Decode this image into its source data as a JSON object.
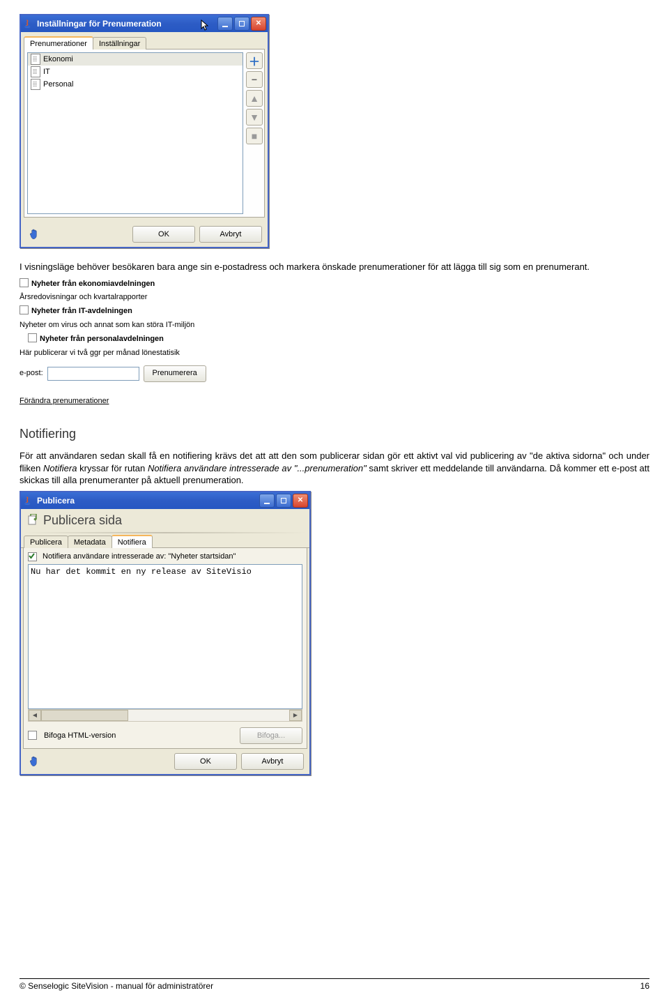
{
  "dialog1": {
    "title": "Inställningar för Prenumeration",
    "tabs": [
      "Prenumerationer",
      "Inställningar"
    ],
    "items": [
      "Ekonomi",
      "IT",
      "Personal"
    ],
    "ok": "OK",
    "cancel": "Avbryt"
  },
  "para1": "I visningsläge behöver besökaren bara ange sin e-postadress och markera önskade prenumerationer för att lägga till sig som en prenumerant.",
  "form": {
    "h1": "Nyheter från ekonomiavdelningen",
    "s1": "Årsredovisningar och kvartalrapporter",
    "h2": "Nyheter från IT-avdelningen",
    "s2": "Nyheter om virus och annat som kan störa IT-miljön",
    "h3": "Nyheter från personalavdelningen",
    "s3": "Här publicerar vi två ggr per månad lönestatisik",
    "eplabel": "e-post:",
    "subscribe": "Prenumerera",
    "change": "Förändra prenumerationer"
  },
  "h2": "Notifiering",
  "para2a": "För att användaren sedan skall få en notifiering krävs det att att den som publicerar sidan gör ett aktivt val vid publicering av \"de aktiva sidorna\" och under fliken ",
  "para2i1": "Notifiera",
  "para2b": " kryssar för rutan ",
  "para2i2": "Notifiera användare intresserade av \"...prenumeration\"",
  "para2c": " samt skriver ett meddelande till användarna. Då kommer ett e-post att skickas till alla prenumeranter på aktuell prenumeration.",
  "dialog2": {
    "titlebar": "Publicera",
    "header": "Publicera sida",
    "tabs": [
      "Publicera",
      "Metadata",
      "Notifiera"
    ],
    "notify": "Notifiera användare intresserade av: \"Nyheter startsidan\"",
    "ta": "Nu har det kommit en ny release av SiteVisio",
    "attach_chk": "Bifoga HTML-version",
    "attach_btn": "Bifoga...",
    "ok": "OK",
    "cancel": "Avbryt"
  },
  "footer": {
    "left": "© Senselogic SiteVision - manual för administratörer",
    "right": "16"
  }
}
